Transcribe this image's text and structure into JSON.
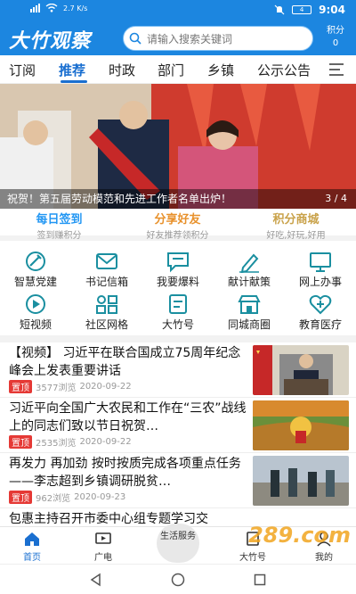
{
  "status_bar": {
    "speed": "2.7 K/s",
    "battery": "4",
    "time": "9:04"
  },
  "header": {
    "logo": "大竹观察",
    "search_placeholder": "请输入搜索关键词",
    "points_label": "积分",
    "points_value": "0"
  },
  "tabs": [
    "订阅",
    "推荐",
    "时政",
    "部门",
    "乡镇",
    "公示公告"
  ],
  "active_tab": "推荐",
  "banner": {
    "caption": "祝贺！第五届劳动模范和先进工作者名单出炉！",
    "page": "3 / 4"
  },
  "quick_links": [
    {
      "title": "每日签到",
      "subtitle": "签到赚积分",
      "color": "#2196f3"
    },
    {
      "title": "分享好友",
      "subtitle": "好友推荐领积分",
      "color": "#e8912b"
    },
    {
      "title": "积分商城",
      "subtitle": "好吃,好玩,好用",
      "color": "#c9a24a"
    }
  ],
  "grid": [
    {
      "label": "智慧党建",
      "icon": "party-hammer-icon"
    },
    {
      "label": "书记信箱",
      "icon": "mail-icon"
    },
    {
      "label": "我要爆料",
      "icon": "chat-icon"
    },
    {
      "label": "献计献策",
      "icon": "pen-icon"
    },
    {
      "label": "网上办事",
      "icon": "monitor-icon"
    },
    {
      "label": "短视频",
      "icon": "play-icon"
    },
    {
      "label": "社区网格",
      "icon": "grid-people-icon"
    },
    {
      "label": "大竹号",
      "icon": "badge-icon"
    },
    {
      "label": "同城商圈",
      "icon": "shop-icon"
    },
    {
      "label": "教育医疗",
      "icon": "medical-icon"
    }
  ],
  "news": [
    {
      "title": "【视频】 习近平在联合国成立75周年纪念峰会上发表重要讲话",
      "badge": "置顶",
      "views": "3577浏览",
      "date": "2020-09-22"
    },
    {
      "title": "习近平向全国广大农民和工作在“三农”战线上的同志们致以节日祝贺…",
      "badge": "置顶",
      "views": "2535浏览",
      "date": "2020-09-22"
    },
    {
      "title": "再发力 再加劲 按时按质完成各项重点任务——李志超到乡镇调研脱贫…",
      "badge": "置顶",
      "views": "962浏览",
      "date": "2020-09-23"
    },
    {
      "title": "包惠主持召开市委中心组专题学习交",
      "badge": "",
      "views": "",
      "date": ""
    }
  ],
  "bottom_nav": [
    {
      "label": "首页",
      "icon": "home-icon"
    },
    {
      "label": "广电",
      "icon": "tv-icon"
    },
    {
      "label": "生活服务",
      "icon": ""
    },
    {
      "label": "大竹号",
      "icon": "badge-icon"
    },
    {
      "label": "我的",
      "icon": "user-icon"
    }
  ],
  "watermark": "289.com",
  "colors": {
    "primary": "#1c86e0",
    "accent": "#1a6fd0",
    "badge": "#e53935"
  }
}
